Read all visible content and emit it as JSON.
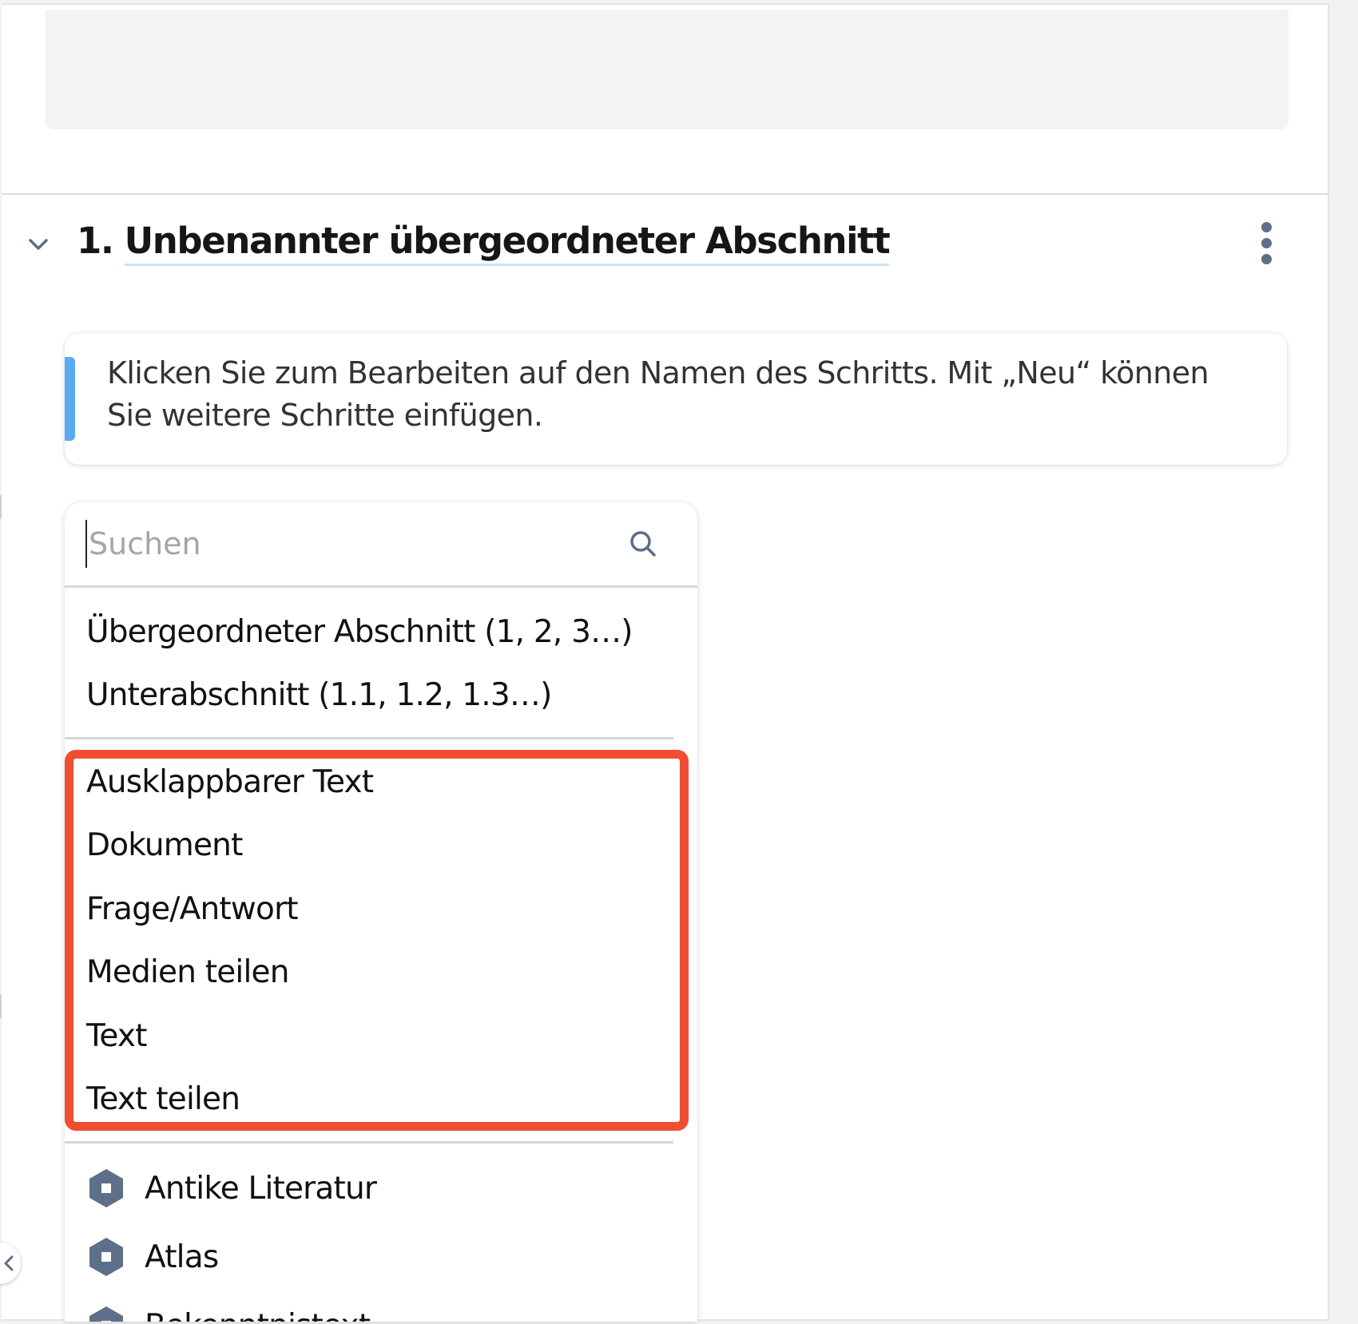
{
  "section": {
    "number": "1.",
    "title": "Unbenannter übergeordneter Abschnitt"
  },
  "info": {
    "text": "Klicken Sie zum Bearbeiten auf den Namen des Schritts. Mit „Neu“ können Sie weitere Schritte einfügen."
  },
  "search": {
    "placeholder": "Suchen",
    "value": ""
  },
  "menu": {
    "section_types": [
      {
        "label": "Übergeordneter Abschnitt (1, 2, 3…)"
      },
      {
        "label": "Unterabschnitt (1.1, 1.2, 1.3…)"
      }
    ],
    "step_types": [
      {
        "label": "Ausklappbarer Text"
      },
      {
        "label": "Dokument"
      },
      {
        "label": "Frage/Antwort"
      },
      {
        "label": "Medien teilen"
      },
      {
        "label": "Text"
      },
      {
        "label": "Text teilen"
      }
    ],
    "modules": [
      {
        "label": "Antike Literatur",
        "icon": "module-hex-icon"
      },
      {
        "label": "Atlas",
        "icon": "module-hex-icon"
      },
      {
        "label": "Bekenntnistext",
        "icon": "module-hex-icon"
      }
    ]
  },
  "colors": {
    "highlight": "#f04e31",
    "accent": "#5aabf2",
    "icon": "#5d6f89"
  }
}
